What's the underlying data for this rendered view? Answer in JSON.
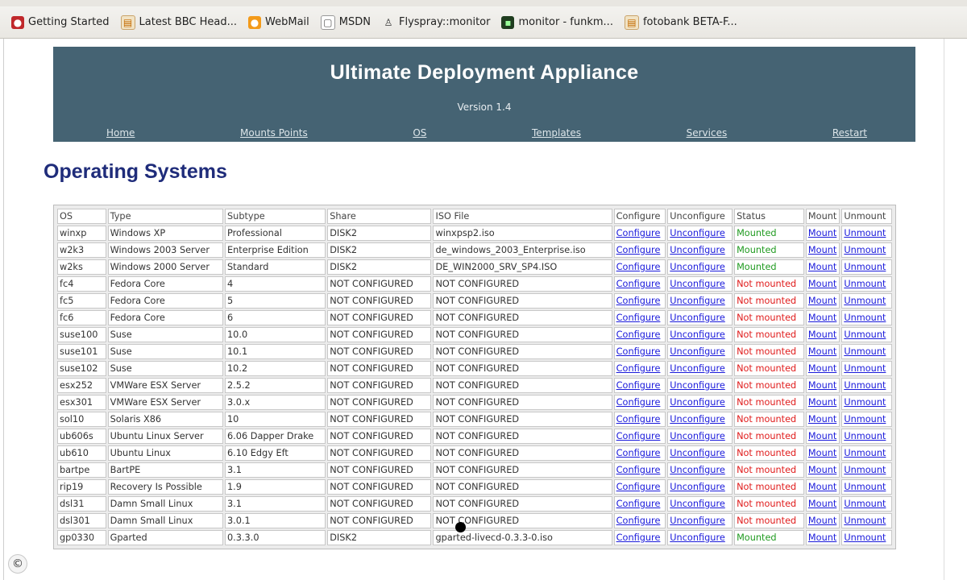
{
  "bookmarks": [
    {
      "label": "Getting Started",
      "icon": "getting-started-icon"
    },
    {
      "label": "Latest BBC Head...",
      "icon": "rss-feed-icon"
    },
    {
      "label": "WebMail",
      "icon": "webmail-icon"
    },
    {
      "label": "MSDN",
      "icon": "page-icon"
    },
    {
      "label": "Flyspray::monitor",
      "icon": "person-icon"
    },
    {
      "label": "monitor - funkm...",
      "icon": "terminal-icon"
    },
    {
      "label": "fotobank BETA-F...",
      "icon": "rss-feed-icon"
    }
  ],
  "banner": {
    "title": "Ultimate Deployment Appliance",
    "version": "Version 1.4",
    "nav": [
      "Home",
      "Mounts Points",
      "OS",
      "Templates",
      "Services",
      "Restart"
    ]
  },
  "heading": "Operating Systems",
  "table": {
    "headers": [
      "OS",
      "Type",
      "Subtype",
      "Share",
      "ISO File",
      "Configure",
      "Unconfigure",
      "Status",
      "Mount",
      "Unmount"
    ],
    "link_labels": {
      "configure": "Configure",
      "unconfigure": "Unconfigure",
      "mount": "Mount",
      "unmount": "Unmount"
    },
    "rows": [
      {
        "os": "winxp",
        "type": "Windows XP",
        "subtype": "Professional",
        "share": "DISK2",
        "iso": "winxpsp2.iso",
        "status": "Mounted"
      },
      {
        "os": "w2k3",
        "type": "Windows 2003 Server",
        "subtype": "Enterprise Edition",
        "share": "DISK2",
        "iso": "de_windows_2003_Enterprise.iso",
        "status": "Mounted"
      },
      {
        "os": "w2ks",
        "type": "Windows 2000 Server",
        "subtype": "Standard",
        "share": "DISK2",
        "iso": "DE_WIN2000_SRV_SP4.ISO",
        "status": "Mounted"
      },
      {
        "os": "fc4",
        "type": "Fedora Core",
        "subtype": "4",
        "share": "NOT CONFIGURED",
        "iso": "NOT CONFIGURED",
        "status": "Not mounted"
      },
      {
        "os": "fc5",
        "type": "Fedora Core",
        "subtype": "5",
        "share": "NOT CONFIGURED",
        "iso": "NOT CONFIGURED",
        "status": "Not mounted"
      },
      {
        "os": "fc6",
        "type": "Fedora Core",
        "subtype": "6",
        "share": "NOT CONFIGURED",
        "iso": "NOT CONFIGURED",
        "status": "Not mounted"
      },
      {
        "os": "suse100",
        "type": "Suse",
        "subtype": "10.0",
        "share": "NOT CONFIGURED",
        "iso": "NOT CONFIGURED",
        "status": "Not mounted"
      },
      {
        "os": "suse101",
        "type": "Suse",
        "subtype": "10.1",
        "share": "NOT CONFIGURED",
        "iso": "NOT CONFIGURED",
        "status": "Not mounted"
      },
      {
        "os": "suse102",
        "type": "Suse",
        "subtype": "10.2",
        "share": "NOT CONFIGURED",
        "iso": "NOT CONFIGURED",
        "status": "Not mounted"
      },
      {
        "os": "esx252",
        "type": "VMWare ESX Server",
        "subtype": "2.5.2",
        "share": "NOT CONFIGURED",
        "iso": "NOT CONFIGURED",
        "status": "Not mounted"
      },
      {
        "os": "esx301",
        "type": "VMWare ESX Server",
        "subtype": "3.0.x",
        "share": "NOT CONFIGURED",
        "iso": "NOT CONFIGURED",
        "status": "Not mounted"
      },
      {
        "os": "sol10",
        "type": "Solaris X86",
        "subtype": "10",
        "share": "NOT CONFIGURED",
        "iso": "NOT CONFIGURED",
        "status": "Not mounted"
      },
      {
        "os": "ub606s",
        "type": "Ubuntu Linux Server",
        "subtype": "6.06 Dapper Drake",
        "share": "NOT CONFIGURED",
        "iso": "NOT CONFIGURED",
        "status": "Not mounted"
      },
      {
        "os": "ub610",
        "type": "Ubuntu Linux",
        "subtype": "6.10 Edgy Eft",
        "share": "NOT CONFIGURED",
        "iso": "NOT CONFIGURED",
        "status": "Not mounted"
      },
      {
        "os": "bartpe",
        "type": "BartPE",
        "subtype": "3.1",
        "share": "NOT CONFIGURED",
        "iso": "NOT CONFIGURED",
        "status": "Not mounted"
      },
      {
        "os": "rip19",
        "type": "Recovery Is Possible",
        "subtype": "1.9",
        "share": "NOT CONFIGURED",
        "iso": "NOT CONFIGURED",
        "status": "Not mounted"
      },
      {
        "os": "dsl31",
        "type": "Damn Small Linux",
        "subtype": "3.1",
        "share": "NOT CONFIGURED",
        "iso": "NOT CONFIGURED",
        "status": "Not mounted"
      },
      {
        "os": "dsl301",
        "type": "Damn Small Linux",
        "subtype": "3.0.1",
        "share": "NOT CONFIGURED",
        "iso": "NOT CONFIGURED",
        "status": "Not mounted"
      },
      {
        "os": "gp0330",
        "type": "Gparted",
        "subtype": "0.3.3.0",
        "share": "DISK2",
        "iso": "gparted-livecd-0.3.3-0.iso",
        "status": "Mounted"
      }
    ]
  },
  "colors": {
    "banner_bg": "#456373",
    "heading": "#1f2c7a",
    "link": "#1a1adb",
    "mounted": "#1f9a1f",
    "not_mounted": "#e01b1b"
  },
  "copyright_symbol": "©"
}
